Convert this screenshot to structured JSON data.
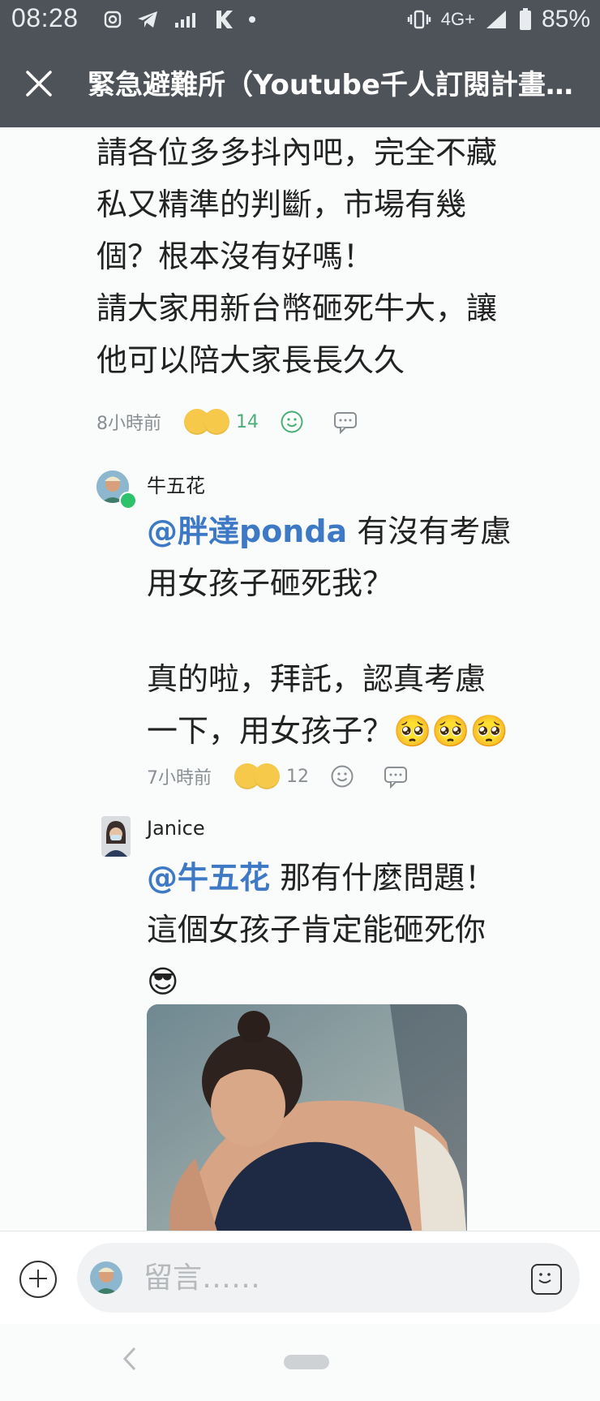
{
  "status_bar": {
    "time": "08:28",
    "network": "4G+",
    "battery": "85%"
  },
  "header": {
    "title": "緊急避難所（Youtube千人訂閱計畫…",
    "close_icon": "close-icon"
  },
  "comments": [
    {
      "lines": [
        "請各位多多抖內吧，完全不藏",
        "私又精準的判斷，市場有幾",
        "個？根本沒有好嗎！",
        "請大家用新台幣砸死牛大，讓",
        "他可以陪大家長長久久"
      ],
      "time": "8小時前",
      "reaction_count": "14"
    },
    {
      "user": "牛五花",
      "mention": "@胖達ponda",
      "lines": [
        " 有沒有考慮",
        "用女孩子砸死我？",
        "",
        "真的啦，拜託，認真考慮",
        "一下，用女孩子？🥺🥺🥺"
      ],
      "time": "7小時前",
      "reaction_count": "12"
    },
    {
      "user": "Janice",
      "mention": "@牛五花",
      "lines": [
        " 那有什麼問題！",
        "這個女孩子肯定能砸死你",
        "😎"
      ]
    }
  ],
  "input": {
    "placeholder": "留言……"
  },
  "colors": {
    "header_bg": "#4d5358",
    "mention": "#3d79c4",
    "like_green": "#4caf78"
  }
}
